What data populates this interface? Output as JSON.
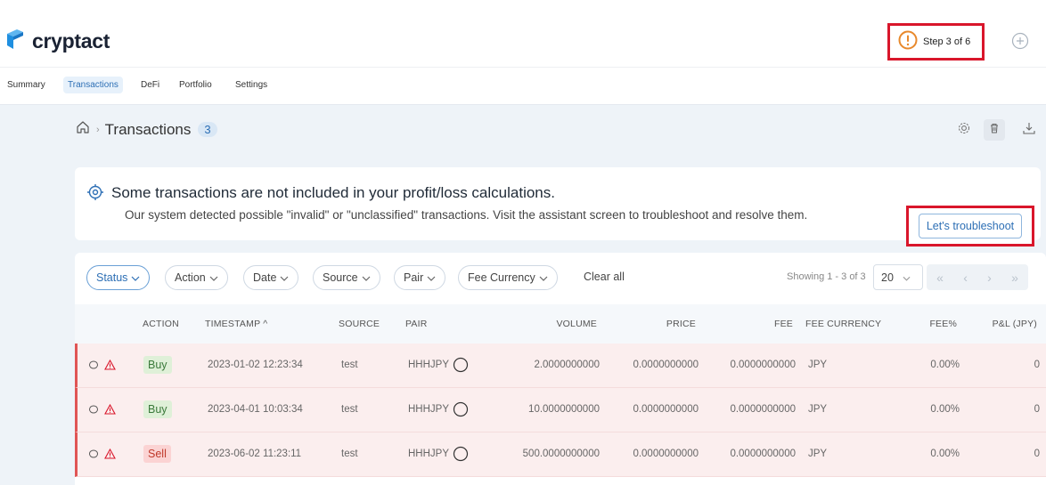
{
  "app": {
    "brand": "cryptact"
  },
  "header": {
    "step_label": "Step 3 of 6"
  },
  "nav": {
    "items": [
      "Summary",
      "Transactions",
      "DeFi",
      "Portfolio",
      "Settings"
    ],
    "active": "Transactions"
  },
  "breadcrumb": {
    "title": "Transactions",
    "count": "3"
  },
  "alert": {
    "title": "Some transactions are not included in your profit/loss calculations.",
    "text": "Our system detected possible \"invalid\" or \"unclassified\" transactions. Visit the assistant screen to troubleshoot and resolve them.",
    "button": "Let's troubleshoot"
  },
  "filters": {
    "status": "Status",
    "action": "Action",
    "date": "Date",
    "source": "Source",
    "pair": "Pair",
    "fee_currency": "Fee Currency",
    "clear_all": "Clear all"
  },
  "pagination": {
    "showing": "Showing 1 - 3 of 3",
    "per_page": "20"
  },
  "table": {
    "headers": {
      "action": "ACTION",
      "timestamp": "TIMESTAMP",
      "source": "SOURCE",
      "pair": "PAIR",
      "volume": "VOLUME",
      "price": "PRICE",
      "fee": "FEE",
      "fee_currency": "FEE CURRENCY",
      "fee_pct": "FEE%",
      "pl": "P&L (JPY)"
    },
    "rows": [
      {
        "action": "Buy",
        "timestamp": "2023-01-02 12:23:34",
        "source": "test",
        "pair": "HHHJPY",
        "volume": "2.0000000000",
        "price": "0.0000000000",
        "fee": "0.0000000000",
        "fee_currency": "JPY",
        "fee_pct": "0.00%",
        "pl": "0"
      },
      {
        "action": "Buy",
        "timestamp": "2023-04-01 10:03:34",
        "source": "test",
        "pair": "HHHJPY",
        "volume": "10.0000000000",
        "price": "0.0000000000",
        "fee": "0.0000000000",
        "fee_currency": "JPY",
        "fee_pct": "0.00%",
        "pl": "0"
      },
      {
        "action": "Sell",
        "timestamp": "2023-06-02 11:23:11",
        "source": "test",
        "pair": "HHHJPY",
        "volume": "500.0000000000",
        "price": "0.0000000000",
        "fee": "0.0000000000",
        "fee_currency": "JPY",
        "fee_pct": "0.00%",
        "pl": "0"
      }
    ]
  },
  "colors": {
    "accent": "#2d6fb5",
    "logo_blue": "#1f8fe0",
    "alert_orange": "#e8892c",
    "error_red": "#e05555",
    "highlight_red": "#d9162b"
  }
}
